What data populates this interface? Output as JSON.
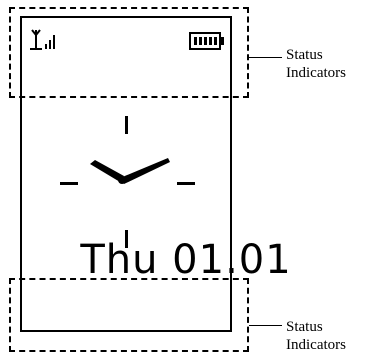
{
  "phone": {
    "date_text": "Thu 01.01",
    "icons": [
      "antenna-signal-icon",
      "battery-icon"
    ]
  },
  "callouts": {
    "top": {
      "line1": "Status",
      "line2": "Indicators"
    },
    "bottom": {
      "line1": "Status",
      "line2": "Indicators"
    }
  }
}
